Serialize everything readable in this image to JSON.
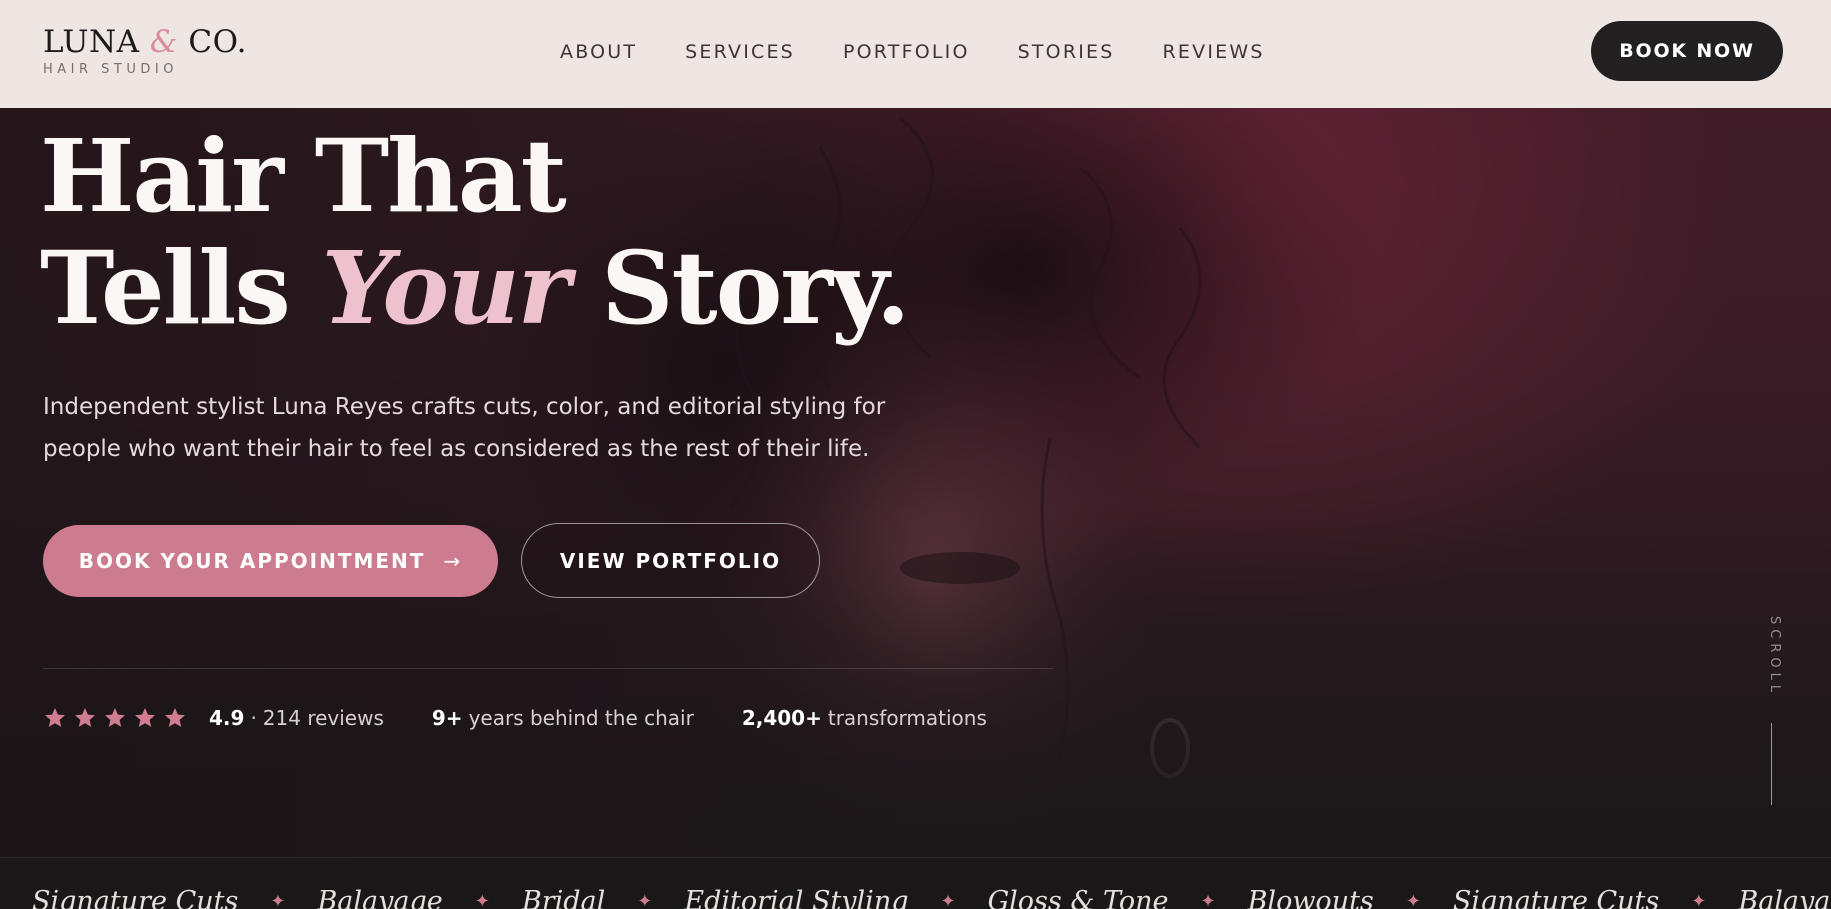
{
  "brand": {
    "name_left": "LUNA",
    "ampersand": "&",
    "name_right": "CO.",
    "tagline": "HAIR STUDIO"
  },
  "nav": {
    "items": [
      {
        "label": "ABOUT"
      },
      {
        "label": "SERVICES"
      },
      {
        "label": "PORTFOLIO"
      },
      {
        "label": "STORIES"
      },
      {
        "label": "REVIEWS"
      }
    ],
    "cta_label": "BOOK NOW"
  },
  "hero": {
    "headline_line1": "Hair That",
    "headline_line2_before": "Tells",
    "headline_accent": "Your",
    "headline_line2_after": "Story.",
    "lede": "Independent stylist Luna Reyes crafts cuts, color, and editorial styling for people who want their hair to feel as considered as the rest of their life.",
    "primary_cta": "BOOK YOUR APPOINTMENT",
    "primary_cta_arrow": "→",
    "secondary_cta": "VIEW PORTFOLIO",
    "scroll_label": "SCROLL"
  },
  "stats": {
    "rating": {
      "stars": 5,
      "value": "4.9",
      "separator": "·",
      "text": "214 reviews"
    },
    "years": {
      "value": "9+",
      "text": "years behind the chair"
    },
    "transformations": {
      "value": "2,400+",
      "text": "transformations"
    }
  },
  "marquee": {
    "separator": "✦",
    "items": [
      "Signature Cuts",
      "Balayage",
      "Bridal",
      "Editorial Styling",
      "Gloss & Tone",
      "Blowouts",
      "Signature Cuts",
      "Balayage"
    ]
  },
  "colors": {
    "header_bg": "#eee6e3",
    "accent_pink": "#cd7b8f",
    "accent_light": "#eec1cf",
    "dark": "#232021",
    "hero_wine": "#3f1c28"
  },
  "icons": {
    "star": "star-icon",
    "arrow": "arrow-right-icon"
  }
}
